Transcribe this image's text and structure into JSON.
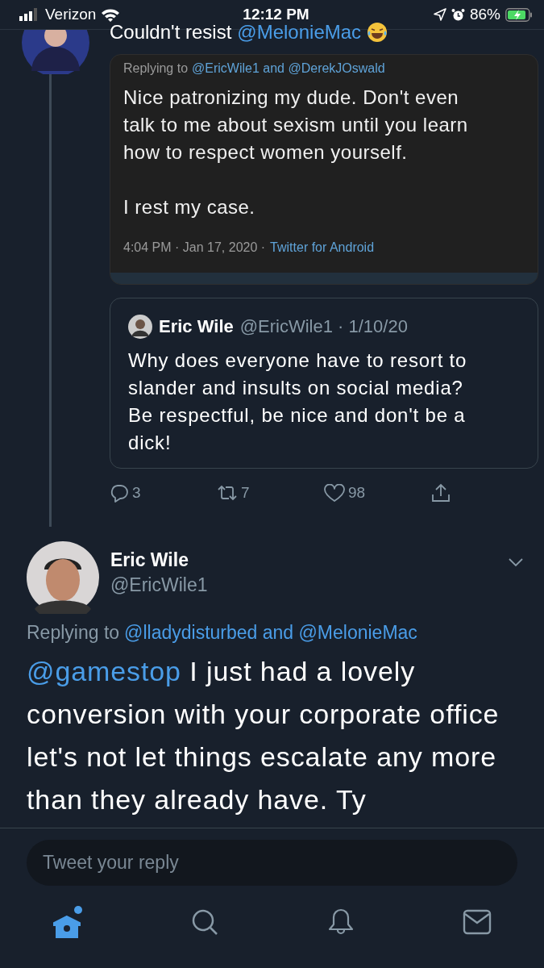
{
  "status_bar": {
    "carrier": "Verizon",
    "time": "12:12 PM",
    "battery": "86%"
  },
  "top_tweet": {
    "text": "Couldn't resist",
    "mention": "@MelonieMac"
  },
  "attached_screenshot": {
    "reply_prefix": "Replying to",
    "reply_handles": "@EricWile1 and @DerekJOswald",
    "paragraphs": [
      "Nice patronizing my dude. Don't even talk to me about sexism until you learn how to respect women yourself.",
      "I rest my case."
    ],
    "meta": "4:04 PM · Jan 17, 2020 ·",
    "source": "Twitter for Android"
  },
  "quoted_tweet": {
    "name": "Eric Wile",
    "handle": "@EricWile1 · 1/10/20",
    "text": "Why does everyone have to resort to slander and insults on social media? Be respectful, be nice and don't be a dick!"
  },
  "actions": [
    {
      "kind": "reply",
      "count": "3"
    },
    {
      "kind": "retweet",
      "count": "7"
    },
    {
      "kind": "like",
      "count": "98"
    },
    {
      "kind": "share"
    }
  ],
  "main_tweet": {
    "name": "Eric Wile",
    "handle": "@EricWile1",
    "reply_prefix": "Replying to",
    "reply_handles": "@lladydisturbed and @MelonieMac",
    "mention": "@gamestop",
    "text": "I just had a lovely conversion with your corporate office let's not let things escalate any more than they already have. Ty"
  },
  "reply_field": {
    "placeholder": "Tweet your reply"
  },
  "tab_bar": [
    {
      "kind": "home",
      "selected": true,
      "unread": true
    },
    {
      "kind": "search",
      "selected": false,
      "unread": false
    },
    {
      "kind": "notifications",
      "selected": false,
      "unread": false
    },
    {
      "kind": "messages",
      "selected": false,
      "unread": false
    }
  ]
}
